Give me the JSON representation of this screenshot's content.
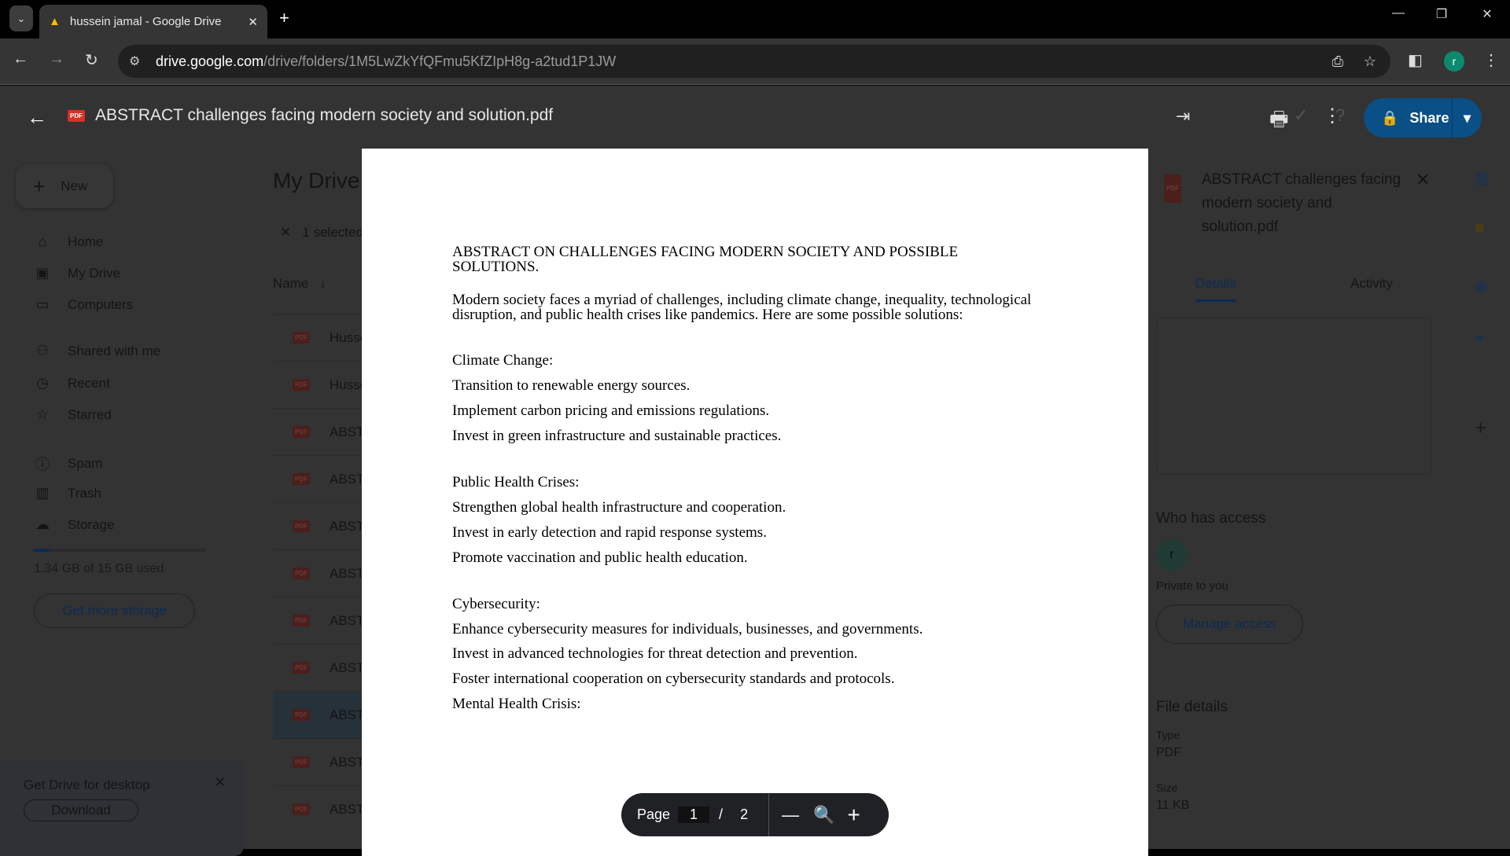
{
  "browser": {
    "tab_title": "hussein jamal - Google Drive",
    "url_host": "drive.google.com",
    "url_path": "/drive/folders/1M5LwZkYfQFmu5KfZIpH8g-a2tud1P1JW",
    "profile_initial": "r"
  },
  "viewer": {
    "file_title": "ABSTRACT challenges facing modern society and solution.pdf",
    "share_label": "Share",
    "page_label": "Page",
    "current_page": "1",
    "page_sep": "/",
    "total_pages": "2"
  },
  "document": {
    "lines": [
      "ABSTRACT ON CHALLENGES FACING MODERN SOCIETY AND POSSIBLE",
      "SOLUTIONS.",
      "Modern society faces a myriad of challenges, including climate change, inequality, technological",
      "disruption, and public health crises like pandemics. Here are some possible solutions:",
      "Climate Change:",
      "Transition to renewable energy sources.",
      "Implement carbon pricing and emissions regulations.",
      "Invest in green infrastructure and sustainable practices.",
      "Public Health Crises:",
      "Strengthen global health infrastructure and cooperation.",
      "Invest in early detection and rapid response systems.",
      "Promote vaccination and public health education.",
      "Cybersecurity:",
      "Enhance cybersecurity measures for individuals, businesses, and governments.",
      "Invest in advanced technologies for threat detection and prevention.",
      "Foster international cooperation on cybersecurity standards and protocols.",
      "Mental Health Crisis:"
    ]
  },
  "sidebar": {
    "new_label": "New",
    "items": [
      "Home",
      "My Drive",
      "Computers",
      "Shared with me",
      "Recent",
      "Starred",
      "Spam",
      "Trash",
      "Storage"
    ],
    "storage_text": "1.34 GB of 15 GB used",
    "storage_fraction": 0.09,
    "get_storage": "Get more storage",
    "promo_title": "Get Drive for desktop",
    "promo_button": "Download"
  },
  "main": {
    "title": "My Drive",
    "selected": "1 selected",
    "name_header": "Name",
    "rows": [
      "Husse",
      "Husse",
      "ABST",
      "ABST",
      "ABST",
      "ABST",
      "ABST",
      "ABST",
      "ABST",
      "ABST",
      "ABST"
    ]
  },
  "details": {
    "title": "ABSTRACT challenges facing modern society and solution.pdf",
    "tab_details": "Details",
    "tab_activity": "Activity",
    "who_has_access": "Who has access",
    "private": "Private to you",
    "manage": "Manage access",
    "file_details": "File details",
    "type_label": "Type",
    "type_value": "PDF",
    "size_label": "Size",
    "size_value": "11 KB"
  }
}
